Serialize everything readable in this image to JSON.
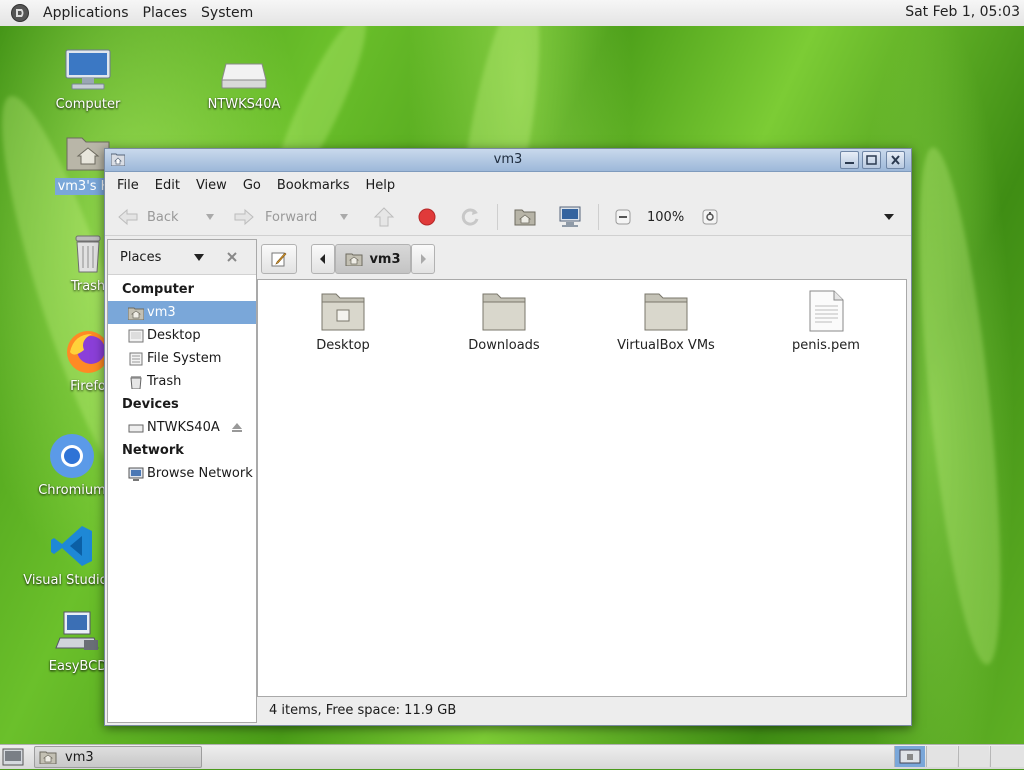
{
  "top_panel": {
    "menus": [
      "Applications",
      "Places",
      "System"
    ],
    "clock": "Sat Feb 1, 05:03"
  },
  "desktop": {
    "icons": [
      {
        "label": "Computer",
        "icon": "computer-icon"
      },
      {
        "label": "NTWKS40A",
        "icon": "drive-icon"
      },
      {
        "label": "vm3's Ho",
        "icon": "home-folder-icon",
        "selected": true
      },
      {
        "label": "Trash",
        "icon": "trash-icon"
      },
      {
        "label": "Firefo",
        "icon": "firefox-icon"
      },
      {
        "label": "Chromium",
        "icon": "chromium-icon"
      },
      {
        "label": "Visual Studio C",
        "icon": "vscode-icon"
      },
      {
        "label": "EasyBCD",
        "icon": "easybcd-icon"
      }
    ]
  },
  "window": {
    "title": "vm3",
    "menu": [
      "File",
      "Edit",
      "View",
      "Go",
      "Bookmarks",
      "Help"
    ],
    "toolbar": {
      "back_label": "Back",
      "forward_label": "Forward",
      "zoom": "100%"
    },
    "sidebar": {
      "header": "Places",
      "sections": [
        {
          "title": "Computer",
          "items": [
            {
              "label": "vm3",
              "icon": "home-icon",
              "selected": true
            },
            {
              "label": "Desktop",
              "icon": "desktop-icon"
            },
            {
              "label": "File System",
              "icon": "filesystem-icon"
            },
            {
              "label": "Trash",
              "icon": "trash-icon"
            }
          ]
        },
        {
          "title": "Devices",
          "items": [
            {
              "label": "NTWKS40A",
              "icon": "drive-icon",
              "eject": true
            }
          ]
        },
        {
          "title": "Network",
          "items": [
            {
              "label": "Browse Network",
              "icon": "network-icon"
            }
          ]
        }
      ]
    },
    "location": {
      "path_button": "vm3"
    },
    "files": [
      {
        "name": "Desktop",
        "type": "folder-desktop"
      },
      {
        "name": "Downloads",
        "type": "folder"
      },
      {
        "name": "VirtualBox VMs",
        "type": "folder"
      },
      {
        "name": "penis.pem",
        "type": "file"
      }
    ],
    "status": "4 items, Free space: 11.9 GB"
  },
  "bottom_panel": {
    "task_label": "vm3"
  },
  "colors": {
    "selection": "#7aa7d9",
    "titlebar": "#9db8d9",
    "stop_red": "#e03a3a",
    "desktop_green": "#4a9a1c"
  }
}
